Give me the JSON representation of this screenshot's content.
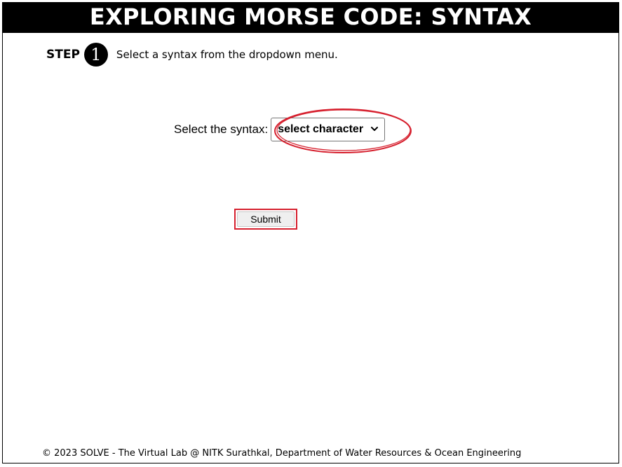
{
  "header": {
    "title": "EXPLORING MORSE CODE: SYNTAX"
  },
  "step": {
    "label": "STEP",
    "number": "1",
    "number_glyph": "❶",
    "instruction": "Select a syntax from the dropdown menu."
  },
  "syntax_select": {
    "label": "Select the syntax:",
    "selected_value": "select character"
  },
  "submit": {
    "label": "Submit"
  },
  "footer": {
    "text": "© 2023 SOLVE - The Virtual Lab @ NITK Surathkal, Department of Water Resources & Ocean Engineering"
  },
  "colors": {
    "title_bg": "#000000",
    "title_fg": "#ffffff",
    "highlight": "#d6202e"
  },
  "icons": {
    "dropdown": "chevron-down-icon",
    "step_badge": "circled-number-icon"
  }
}
